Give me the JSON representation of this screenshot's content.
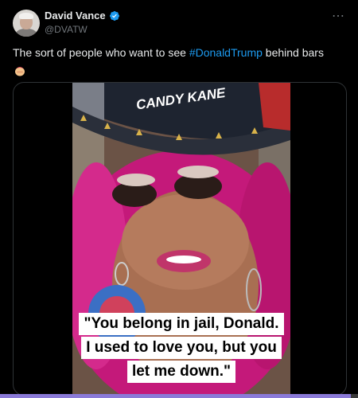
{
  "author": {
    "display_name": "David Vance",
    "handle": "@DVATW",
    "verified": true
  },
  "more_icon": "⋯",
  "tweet": {
    "text_before": "The sort of people who want to see ",
    "hashtag": "#DonaldTrump",
    "text_after": " behind bars",
    "emoji": "face-palm-emoji"
  },
  "media": {
    "hat_text": "CANDY KANE",
    "caption_lines": [
      "\"You belong in jail, Donald.",
      "I used to love you, but you",
      "let me down.\""
    ]
  },
  "video_progress": {
    "fraction": 0.98
  },
  "colors": {
    "accent": "#1d9bf0",
    "hair": "#c4197a",
    "progress": "#8b7ad8"
  }
}
